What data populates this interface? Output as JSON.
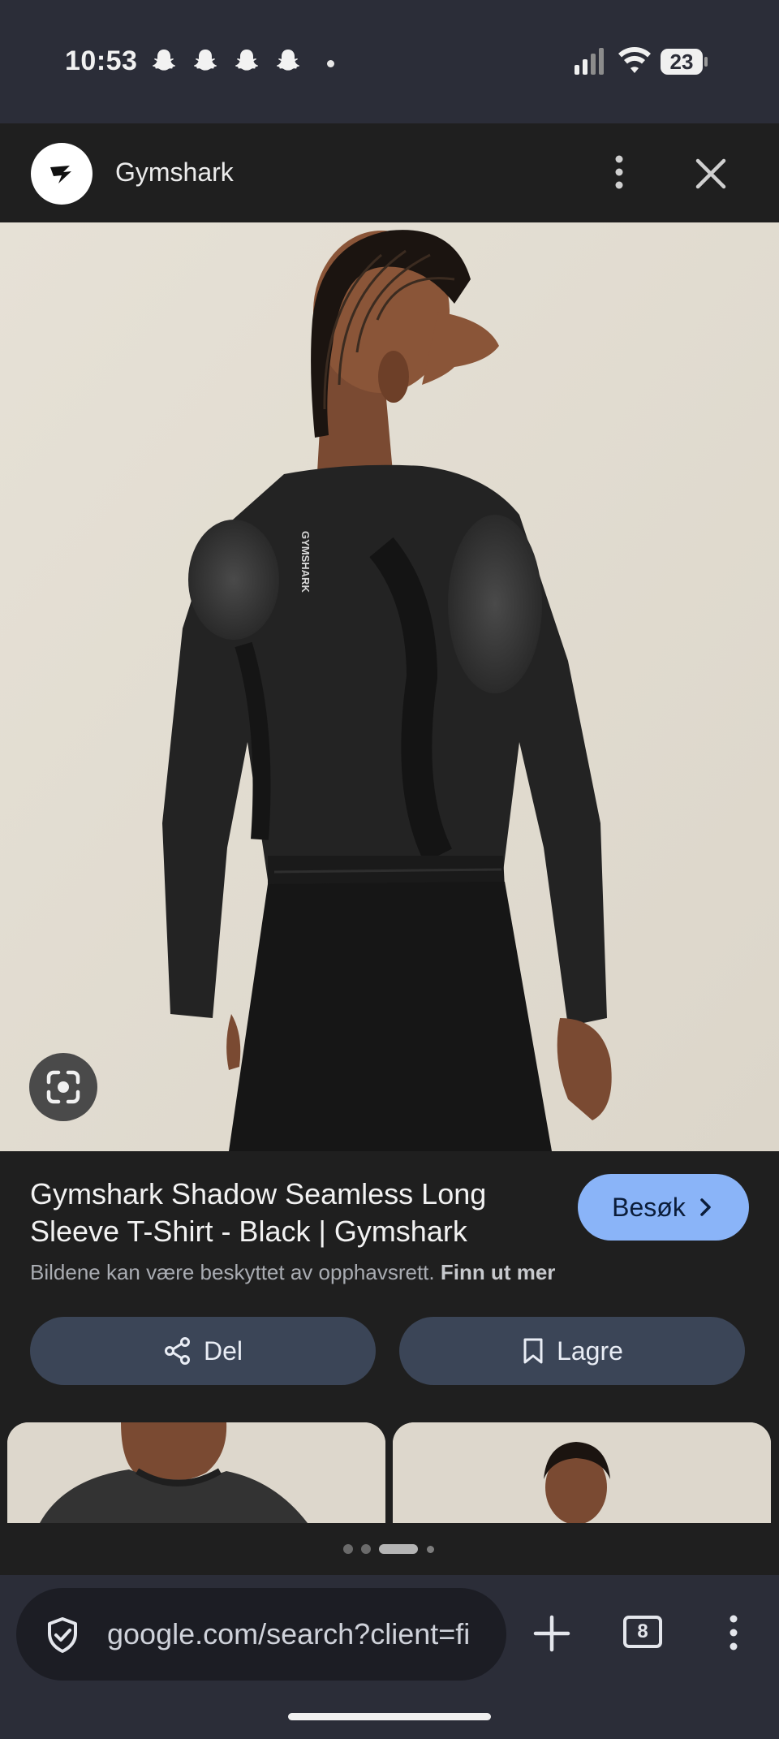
{
  "status_bar": {
    "time": "10:53",
    "battery": "23",
    "notification_icons": [
      "snapchat-icon",
      "snapchat-icon",
      "snapchat-icon",
      "snapchat-icon"
    ]
  },
  "header": {
    "site_name": "Gymshark"
  },
  "product": {
    "title": "Gymshark Shadow Seamless Long Sleeve T-Shirt - Black | Gymshark",
    "visit_label": "Besøk",
    "copyright_text": "Bildene kan være beskyttet av opphavsrett.",
    "copyright_link": "Finn ut mer",
    "shirt_logo_text": "GYMSHARK"
  },
  "actions": {
    "share_label": "Del",
    "save_label": "Lagre"
  },
  "page_indicator": {
    "count": 4,
    "active_index": 2
  },
  "browser": {
    "url": "google.com/search?client=fi",
    "tab_count": "8"
  },
  "colors": {
    "accent": "#8ab4f8",
    "action_button": "#3b4557",
    "panel_bg": "#1f1f1f",
    "system_bg": "#2b2d38"
  }
}
